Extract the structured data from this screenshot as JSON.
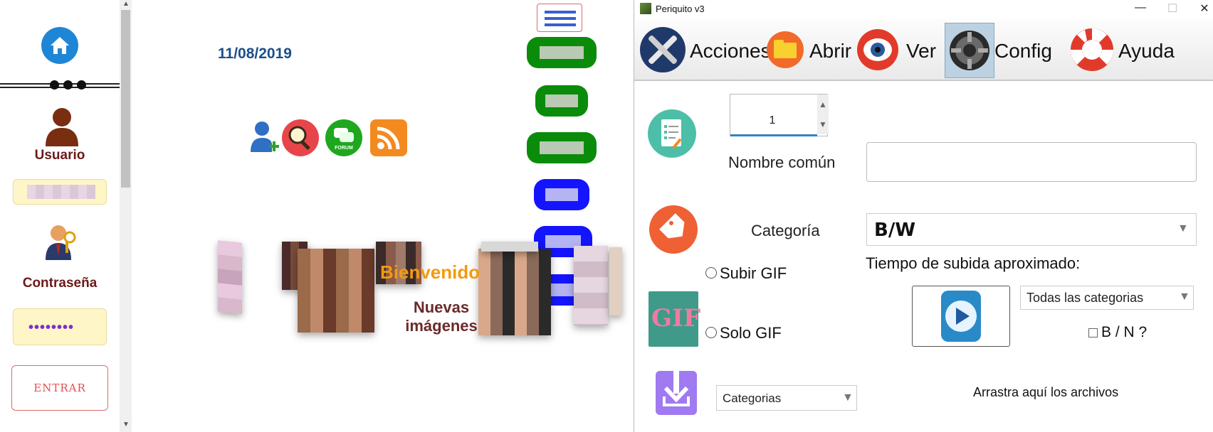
{
  "sidebar": {
    "home_icon": "home-icon",
    "more_icon": "more-dots-icon",
    "user_label": "Usuario",
    "password_label": "Contraseña",
    "password_mask": "••••••••",
    "login_button": "ENTRAR"
  },
  "page": {
    "date": "11/08/2019",
    "welcome": "Bienvenido",
    "new_images": "Nuevas imágenes",
    "icons": [
      "add-user-icon",
      "search-icon",
      "forum-icon",
      "rss-icon"
    ],
    "forum_text": "FORUM"
  },
  "window": {
    "title": "Periquito v3",
    "minimize": "—",
    "maximize": "☐",
    "close": "✕",
    "toolbar": {
      "acciones": "Acciones",
      "abrir": "Abrir",
      "ver": "Ver",
      "config": "Config",
      "ayuda": "Ayuda"
    },
    "form": {
      "number_value": "1",
      "nombre_label": "Nombre común",
      "nombre_value": "",
      "categoria_label": "Categoría",
      "categoria_value": "B/W",
      "subir_gif": "Subir GIF",
      "solo_gif": "Solo GIF",
      "gif_badge": "GIF",
      "tiempo_label": "Tiempo de subida aproximado:",
      "todas_value": "Todas las categorias",
      "bn_label": "B / N ?",
      "categorias_value": "Categorias",
      "drop_label": "Arrastra aquí los archivos"
    }
  }
}
